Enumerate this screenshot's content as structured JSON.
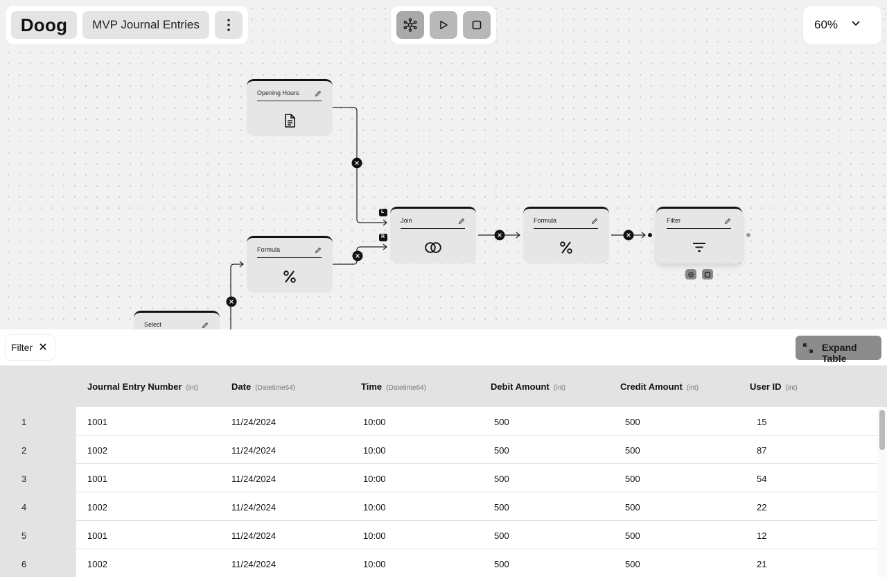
{
  "app": {
    "logo": "Doog",
    "project_title": "MVP Journal Entries",
    "zoom": "60%"
  },
  "nodes": {
    "opening_hours": "Opening Hours",
    "formula_left": "Formula",
    "join": "Join",
    "formula_right": "Formula",
    "filter": "Filter",
    "select": "Select"
  },
  "join_inputs": {
    "left": "L",
    "right": "R"
  },
  "bottom": {
    "filter_chip": "Filter",
    "expand_label": "Expand Table"
  },
  "table": {
    "columns": [
      {
        "name": "Journal Entry Number",
        "type": "(int)"
      },
      {
        "name": "Date",
        "type": "(Datetime64)"
      },
      {
        "name": "Time",
        "type": "(Datetime64)"
      },
      {
        "name": "Debit Amount",
        "type": "(int)"
      },
      {
        "name": "Credit Amount",
        "type": "(int)"
      },
      {
        "name": "User ID",
        "type": "(int)"
      }
    ],
    "rows": [
      {
        "n": "1",
        "cells": [
          "1001",
          "11/24/2024",
          "10:00",
          "500",
          "500",
          "15"
        ]
      },
      {
        "n": "2",
        "cells": [
          "1002",
          "11/24/2024",
          "10:00",
          "500",
          "500",
          "87"
        ]
      },
      {
        "n": "3",
        "cells": [
          "1001",
          "11/24/2024",
          "10:00",
          "500",
          "500",
          "54"
        ]
      },
      {
        "n": "4",
        "cells": [
          "1002",
          "11/24/2024",
          "10:00",
          "500",
          "500",
          "22"
        ]
      },
      {
        "n": "5",
        "cells": [
          "1001",
          "11/24/2024",
          "10:00",
          "500",
          "500",
          "12"
        ]
      },
      {
        "n": "6",
        "cells": [
          "1002",
          "11/24/2024",
          "10:00",
          "500",
          "500",
          "21"
        ]
      }
    ]
  },
  "icons": {
    "more": "vertical-dots-icon",
    "graph": "network-graph-icon",
    "play": "play-icon",
    "stop": "stop-icon",
    "chevron": "chevron-down-icon",
    "edit": "pencil-icon",
    "document": "document-icon",
    "percent": "percent-icon",
    "join": "join-circles-icon",
    "filter": "filter-lines-icon",
    "close": "close-icon",
    "expand": "expand-icon"
  }
}
